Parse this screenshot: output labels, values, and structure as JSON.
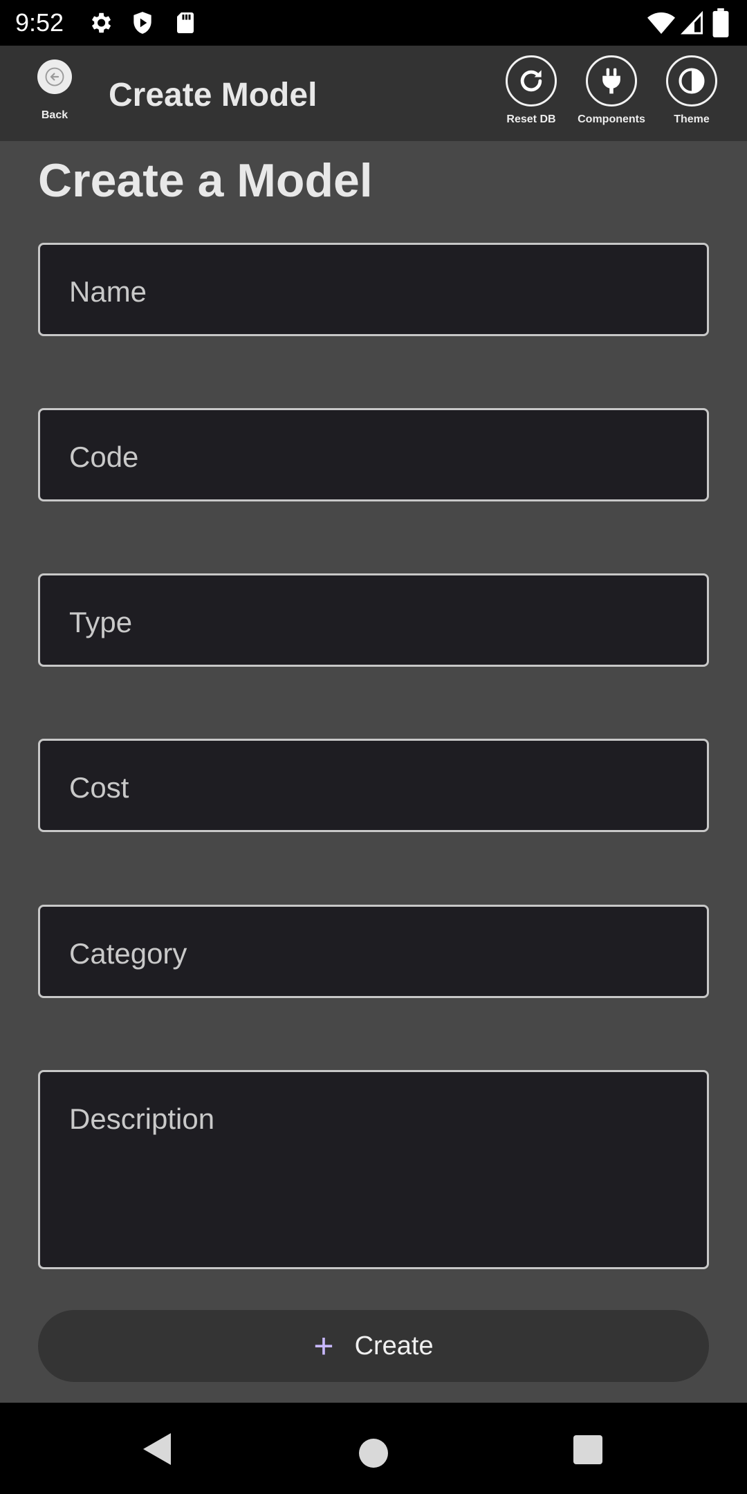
{
  "status_bar": {
    "time": "9:52",
    "left_icons": [
      "gear-icon",
      "shield-icon",
      "sd-card-icon"
    ],
    "right_icons": [
      "wifi-icon",
      "signal-icon",
      "battery-icon"
    ]
  },
  "app_bar": {
    "back_label": "Back",
    "title": "Create Model",
    "actions": [
      {
        "label": "Reset DB",
        "icon": "refresh-icon"
      },
      {
        "label": "Components",
        "icon": "plug-icon"
      },
      {
        "label": "Theme",
        "icon": "contrast-icon"
      }
    ]
  },
  "form": {
    "heading": "Create a Model",
    "fields": {
      "name": {
        "placeholder": "Name",
        "value": ""
      },
      "code": {
        "placeholder": "Code",
        "value": ""
      },
      "type": {
        "placeholder": "Type",
        "value": ""
      },
      "cost": {
        "placeholder": "Cost",
        "value": ""
      },
      "category": {
        "placeholder": "Category",
        "value": ""
      },
      "description": {
        "placeholder": "Description",
        "value": ""
      }
    },
    "submit_label": "Create"
  },
  "colors": {
    "background": "#484848",
    "app_bar": "#333333",
    "field_bg": "#1e1d22",
    "accent": "#c8b8ff"
  }
}
